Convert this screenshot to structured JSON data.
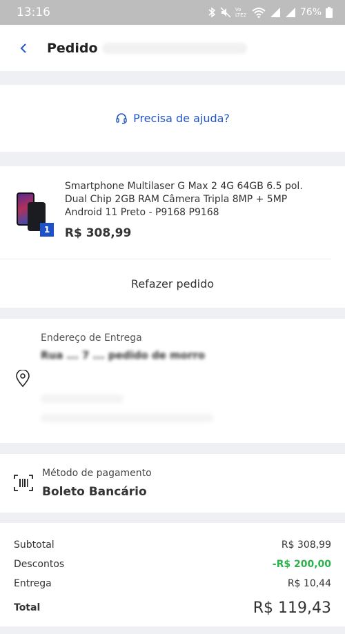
{
  "status_bar": {
    "time": "13:16",
    "battery": "76%",
    "network_label": "Vo LTE2"
  },
  "header": {
    "title": "Pedido"
  },
  "help": {
    "label": "Precisa de ajuda?"
  },
  "product": {
    "name": "Smartphone Multilaser G Max 2 4G 64GB 6.5 pol. Dual Chip 2GB RAM Câmera Tripla 8MP + 5MP Android 11 Preto - P9168 P9168",
    "price": "R$ 308,99",
    "quantity": "1",
    "reorder_label": "Refazer pedido"
  },
  "address": {
    "label": "Endereço de Entrega",
    "line": "Rua ... 7 ... pedido de morro"
  },
  "payment": {
    "label": "Método de pagamento",
    "value": "Boleto Bancário"
  },
  "summary": {
    "subtotal_label": "Subtotal",
    "subtotal_value": "R$ 308,99",
    "discount_label": "Descontos",
    "discount_value": "-R$ 200,00",
    "delivery_label": "Entrega",
    "delivery_value": "R$ 10,44",
    "total_label": "Total",
    "total_value": "R$ 119,43"
  },
  "colors": {
    "accent": "#2356c9",
    "discount": "#2bb24c",
    "badge": "#1e50c8"
  }
}
